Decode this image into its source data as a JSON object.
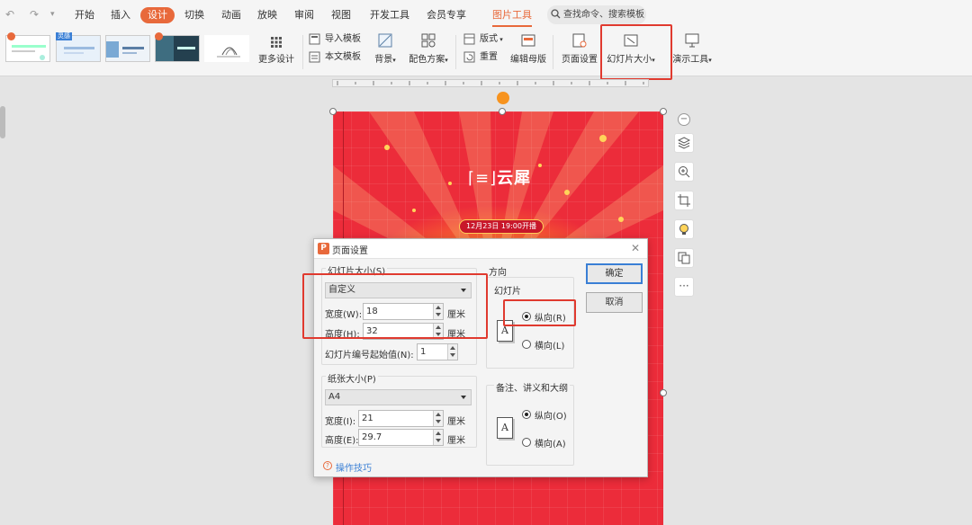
{
  "menubar": {
    "undo_icon": "undo-icon",
    "redo_icon": "redo-icon",
    "items": [
      "开始",
      "插入",
      "设计",
      "切换",
      "动画",
      "放映",
      "审阅",
      "视图",
      "开发工具",
      "会员专享"
    ],
    "active": "设计",
    "picture_tools": "图片工具",
    "search_placeholder": "查找命令、搜索模板"
  },
  "ribbon": {
    "thumb_badge": "灵感",
    "more_design": "更多设计",
    "import_template": "导入模板",
    "text_template": "本文模板",
    "background": "背景",
    "color_scheme": "配色方案",
    "layout": "版式",
    "reset": "重置",
    "edit_master": "编辑母版",
    "page_setup": "页面设置",
    "slide_size": "幻灯片大小",
    "presenter_tools": "演示工具"
  },
  "slide": {
    "logo_text": "云犀",
    "date_text": "12月23日 19:00开播"
  },
  "dialog": {
    "title": "页面设置",
    "slide_size_label": "幻灯片大小(S)",
    "slide_size_value": "自定义",
    "width_label": "宽度(W):",
    "width_value": "18",
    "height_label": "高度(H):",
    "height_value": "32",
    "unit": "厘米",
    "numbering_label": "幻灯片编号起始值(N):",
    "numbering_value": "1",
    "paper_size_label": "纸张大小(P)",
    "paper_size_value": "A4",
    "paper_width_label": "宽度(I):",
    "paper_width_value": "21",
    "paper_height_label": "高度(E):",
    "paper_height_value": "29.7",
    "orientation_label": "方向",
    "slides_group": "幻灯片",
    "portrait_r": "纵向(R)",
    "landscape_l": "横向(L)",
    "notes_group": "备注、讲义和大纲",
    "portrait_o": "纵向(O)",
    "landscape_a": "横向(A)",
    "ok": "确定",
    "cancel": "取消",
    "tips": "操作技巧"
  },
  "colors": {
    "accent": "#e8693b",
    "highlight": "#e03a2f",
    "primary_button_border": "#3a7fd5"
  }
}
